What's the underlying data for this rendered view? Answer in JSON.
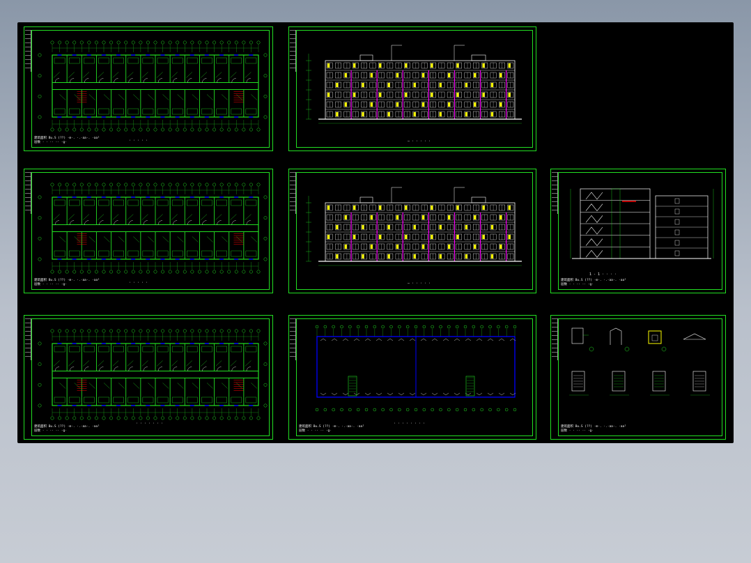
{
  "viewer": {
    "background_color": "#000000",
    "line_color": "#22e022",
    "accent_colors": [
      "#ffff00",
      "#ff00ff",
      "#0000ff",
      "#ff0000",
      "#ffffff"
    ]
  },
  "sheets": [
    {
      "id": "s1",
      "kind": "floor-plan",
      "caption": "· · · · ·",
      "note": "建筑面积 Bu.S (??) ·m·. ·.·aa·. ·aa²\n层数 · · ·· ·· ·g·"
    },
    {
      "id": "s2",
      "kind": "elevation",
      "caption": "— · · · · ·",
      "note": ""
    },
    {
      "id": "s3",
      "kind": "empty",
      "caption": "",
      "note": ""
    },
    {
      "id": "s4",
      "kind": "floor-plan",
      "caption": "· · · · ·",
      "note": "建筑面积 Bu.S (??) ·m·. ·.·aa·. ·aa²\n层数 · · ·· ·· ·g·"
    },
    {
      "id": "s5",
      "kind": "elevation",
      "caption": "— · · · · ·",
      "note": ""
    },
    {
      "id": "s6",
      "kind": "section",
      "caption": "1 - 1 · · · ·",
      "note": "建筑面积 Bu.S (??) ·m·. ·.·aa·. ·aa²\n层数 · · ·· ·· ·g·"
    },
    {
      "id": "s7",
      "kind": "floor-plan",
      "caption": "· · · · · · ·",
      "note": "建筑面积 Bu.S (??) ·m·. ·.·aa·. ·aa²\n层数 · · ·· ·· ·g·"
    },
    {
      "id": "s8",
      "kind": "roof-plan",
      "caption": "· · · · · · · ·",
      "note": "建筑面积 Bu.S (??) ·m·. ·.·aa·. ·aa²\n层数 · · ·· ·· ·g·"
    },
    {
      "id": "s9",
      "kind": "details",
      "caption": "",
      "note": "建筑面积 Bu.S (??) ·m·. ·.·aa·. ·aa²\n层数 · · ·· ·· ·g·"
    }
  ]
}
